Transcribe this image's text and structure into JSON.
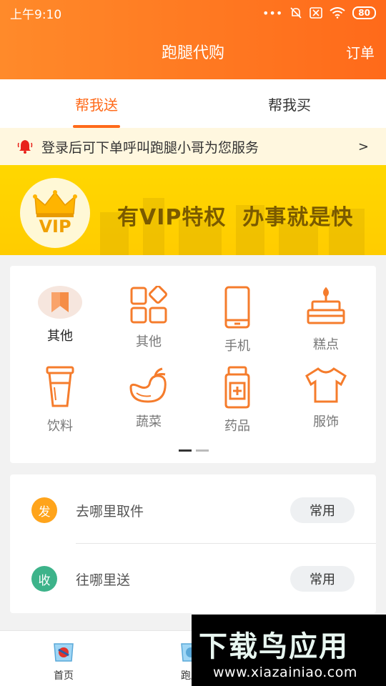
{
  "status_bar": {
    "time": "上午9:10",
    "icons": [
      "more-dots-icon",
      "mute-icon",
      "sim-off-icon",
      "wifi-icon"
    ],
    "battery": "80"
  },
  "header": {
    "title": "跑腿代购",
    "right_action": "订单"
  },
  "tabs": [
    {
      "label": "帮我送",
      "active": true
    },
    {
      "label": "帮我买",
      "active": false
    }
  ],
  "notice": {
    "icon": "bell-icon",
    "text": "登录后可下单呼叫跑腿小哥为您服务",
    "chevron": ">"
  },
  "banner": {
    "badge_text": "VIP",
    "slogan": "有VIP特权  办事就是快"
  },
  "categories": [
    {
      "label": "其他",
      "icon": "bookmark-icon",
      "selected": true
    },
    {
      "label": "其他",
      "icon": "grid-blocks-icon",
      "selected": false
    },
    {
      "label": "手机",
      "icon": "phone-icon",
      "selected": false
    },
    {
      "label": "糕点",
      "icon": "cake-icon",
      "selected": false
    },
    {
      "label": "饮料",
      "icon": "cup-icon",
      "selected": false
    },
    {
      "label": "蔬菜",
      "icon": "eggplant-icon",
      "selected": false
    },
    {
      "label": "药品",
      "icon": "medicine-bottle-icon",
      "selected": false
    },
    {
      "label": "服饰",
      "icon": "tshirt-icon",
      "selected": false
    }
  ],
  "pager": {
    "pages": 2,
    "current": 1
  },
  "address": {
    "pickup": {
      "badge": "发",
      "text": "去哪里取件",
      "fav": "常用",
      "color": "#ffa41b"
    },
    "delivery": {
      "badge": "收",
      "text": "往哪里送",
      "fav": "常用",
      "color": "#3db38a"
    }
  },
  "tabbar": [
    {
      "label": "首页",
      "icon": "home-icon"
    },
    {
      "label": "跑腿",
      "icon": "errand-icon"
    }
  ],
  "watermark": {
    "title": "下载鸟应用",
    "url": "www.xiazainiao.com"
  },
  "colors": {
    "accent": "#ff6a1a",
    "banner": "#ffd200",
    "notice_bg": "#fff7df"
  }
}
